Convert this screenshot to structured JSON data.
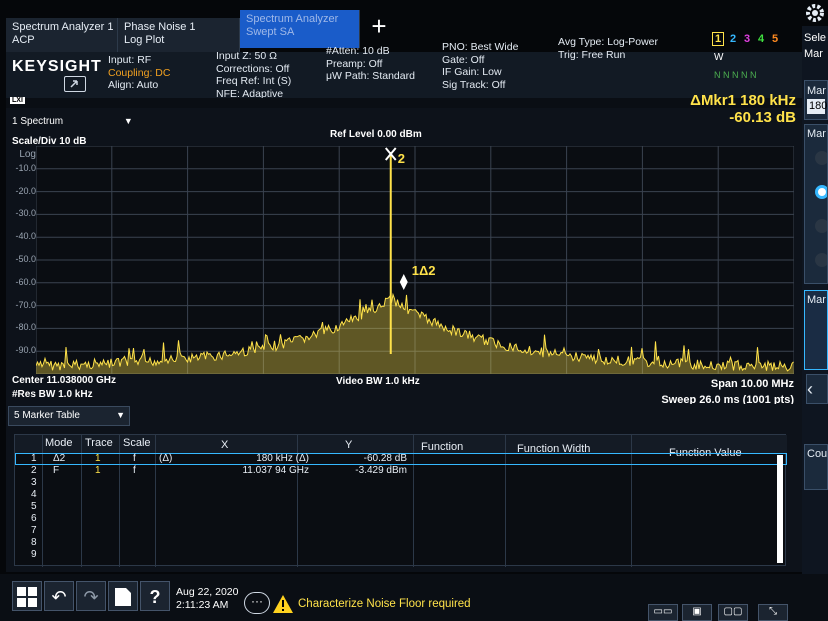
{
  "tabs": [
    {
      "label": "Spectrum Analyzer 1",
      "sub": "ACP"
    },
    {
      "label": "Phase Noise 1",
      "sub": "Log Plot"
    },
    {
      "label": "Spectrum Analyzer",
      "sub": "Swept SA"
    }
  ],
  "add_tab_label": "+",
  "logo": "KEYSIGHT",
  "header": {
    "col1": [
      "Input: RF",
      "Coupling: DC",
      "Align: Auto"
    ],
    "col2": [
      "Input Z: 50 Ω",
      "Corrections: Off",
      "Freq Ref: Int (S)",
      "NFE: Adaptive"
    ],
    "col3": [
      "#Atten: 10 dB",
      "Preamp: Off",
      "μW Path: Standard"
    ],
    "col4": [
      "PNO: Best Wide",
      "Gate: Off",
      "IF Gain: Low",
      "Sig Track: Off"
    ],
    "col5": [
      "Avg Type: Log-Power",
      "Trig: Free Run"
    ],
    "trace_numbers": [
      "1",
      "2",
      "3",
      "4",
      "5"
    ],
    "trace_colors": [
      "#ffe24a",
      "#36b8ff",
      "#e040e0",
      "#40e040",
      "#ff8a20"
    ],
    "trace_type": "W",
    "trace_detectors": "N N N N N",
    "lxi_label": "LXI"
  },
  "marker_readout": {
    "label": "ΔMkr1  180 kHz",
    "value": "-60.13 dB"
  },
  "spectrum": {
    "window_title": "1 Spectrum",
    "scale": "Scale/Div 10 dB",
    "ref_level": "Ref Level 0.00 dBm",
    "scale_type": "Log",
    "y_ticks": [
      "-10.0",
      "-20.0",
      "-30.0",
      "-40.0",
      "-50.0",
      "-60.0",
      "-70.0",
      "-80.0",
      "-90.0"
    ],
    "marker2_label": "2",
    "marker1_label": "1Δ2",
    "trace_color": "#ffe24a",
    "center": "Center 11.038000 GHz",
    "res_bw": "#Res BW 1.0 kHz",
    "video_bw": "Video BW 1.0 kHz",
    "span": "Span 10.00 MHz",
    "sweep": "Sweep 26.0 ms (1001 pts)"
  },
  "marker_table": {
    "title": "5 Marker Table",
    "headers": [
      "Mode",
      "Trace",
      "Scale",
      "X",
      "Y",
      "Function",
      "Function Width",
      "Function Value"
    ],
    "rows": [
      {
        "num": "1",
        "mode": "Δ2",
        "trace": "1",
        "scale": "f",
        "delta": "(Δ)",
        "x": "180 kHz (Δ)",
        "y": "-60.28 dB"
      },
      {
        "num": "2",
        "mode": "F",
        "trace": "1",
        "scale": "f",
        "delta": "",
        "x": "11.037 94 GHz",
        "y": "-3.429 dBm"
      },
      {
        "num": "3"
      },
      {
        "num": "4"
      },
      {
        "num": "5"
      },
      {
        "num": "6"
      },
      {
        "num": "7"
      },
      {
        "num": "8"
      },
      {
        "num": "9"
      }
    ]
  },
  "taskbar": {
    "date": "Aug 22, 2020",
    "time": "2:11:23 AM",
    "alert": "Characterize Noise Floor required"
  },
  "sidebar": {
    "select_label": "Sele",
    "select_sub": "Mar",
    "items": [
      "Mar",
      "180",
      "Mar",
      "Mar",
      "Cou"
    ]
  }
}
